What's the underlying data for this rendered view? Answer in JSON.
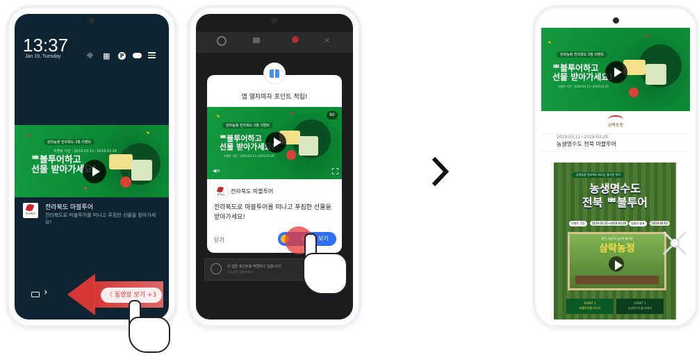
{
  "phone1": {
    "time": "13:37",
    "date": "Jan 19, Tuesday",
    "ad": {
      "tag": "삼락농정 전라북도 3월 이벤트",
      "headline": "ᄈ블투어하고\n선물 받아가세요!",
      "period": "이벤트 기간 : 2019.03.11~2019.03.29"
    },
    "notification": {
      "logo": "전라북도",
      "title": "전라북도 마블투어",
      "body": "전라북도로 마블투어를 떠나고 푸짐한 선물을 받아가세요!"
    },
    "swipe_button": "〈 동영상 보기 +3",
    "lock_arrow": "›"
  },
  "phone2": {
    "popup": {
      "title": "앱 열자마자 포인트 적립!",
      "badge": "60",
      "ad": {
        "tag": "삼락농정 전라북도 3월 이벤트",
        "headline": "ᄈ블투어하고\n선물 받아가세요!",
        "period": "이벤트 기간 : 2019.03.11~2019.03.29"
      },
      "advertiser": "전라북도 마블투어",
      "advertiser_logo": "전라북도",
      "message": "전라북도로 마블투어를 떠나고 푸짐한 선물을 받아가세요!",
      "close_label": "닫기",
      "cta_label": "동영상 보기"
    },
    "bottom_bar": {
      "line1": "이 앱은 포인트를 적립하고 있습니다?",
      "line2": "지금 바로 적립하세요!"
    }
  },
  "arrow": "›",
  "phone3": {
    "ad": {
      "tag": "삼락농정 전라북도 3월 이벤트",
      "headline": "ᄈ블투어하고\n선물 받아가세요!",
      "period": "이벤트 기간 : 2019.03.11~2019.03.29"
    },
    "brand": "삼락농정",
    "date_range": "2019.03.11~2019.03.29",
    "title": "농생명수도 전북 마블투어",
    "poster": {
      "tag": "삼락농정 전라북도 떠나는 즐거운 투어",
      "headline": "농생명수도\n전북 ᄈ블투어",
      "pills": [
        "이벤트 기간",
        "2019.03.11~2019.03.29",
        "당첨자 발표",
        "2019.04.03"
      ],
      "video_sub": "농민, 농촌이 농촌이 즐거운",
      "video_title": "삼락농정",
      "event1": "EVENT 1\n마블투어를 떠나라",
      "event2": "EVENT 2\n농생명수도를 봐봐라"
    }
  },
  "colors": {
    "green": "#0b8a34",
    "dark_green": "#0a5a26",
    "blue": "#2f6ff0",
    "red": "#e53935",
    "lock_bg": "#0f2433"
  }
}
